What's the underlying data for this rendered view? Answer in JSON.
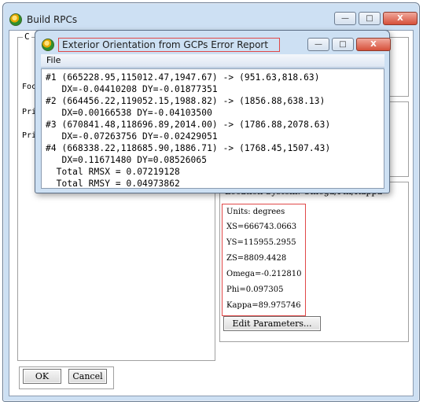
{
  "main_window": {
    "title": "Build RPCs",
    "groupbox_label": "C",
    "side_labels": [
      "Foc",
      "Pri",
      "Pri"
    ],
    "location_system_text": "Location System: Omega/Phi/Kappa",
    "params": {
      "units": "Units: degrees",
      "xs": "XS=666743.0663",
      "ys": "YS=115955.2955",
      "zs": "ZS=8809.4428",
      "omega": "Omega=-0.212810",
      "phi": "Phi=0.097305",
      "kappa": "Kappa=89.975746"
    },
    "edit_parameters_label": "Edit Parameters...",
    "ok_label": "OK",
    "cancel_label": "Cancel"
  },
  "dialog": {
    "title": "Exterior Orientation from GCPs Error Report",
    "menu_file": "File",
    "lines": [
      "#1 (665228.95,115012.47,1947.67) -> (951.63,818.63)",
      "   DX=-0.04410208 DY=-0.01877351",
      "#2 (664456.22,119052.15,1988.82) -> (1856.88,638.13)",
      "   DX=0.00166538 DY=-0.04103500",
      "#3 (670841.48,118696.89,2014.00) -> (1786.88,2078.63)",
      "   DX=-0.07263756 DY=-0.02429051",
      "#4 (668338.22,118685.90,1886.71) -> (1768.45,1507.43)",
      "   DX=0.11671480 DY=0.08526065",
      "  Total RMSX = 0.07219128",
      "  Total RMSY = 0.04973862"
    ]
  },
  "caption_glyphs": {
    "minimize": "—",
    "maximize": "□",
    "close": "X"
  },
  "colors": {
    "frame": "#cde0f3",
    "highlight_box": "#e04848",
    "close_button": "#d6503a"
  }
}
